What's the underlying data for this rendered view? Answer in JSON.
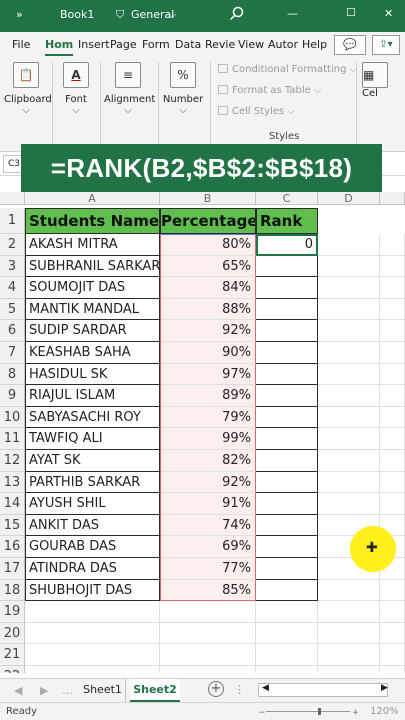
{
  "titlebar": {
    "qat": "»",
    "filename": "Book1",
    "sensitivity": "General",
    "search_icon": "search-icon",
    "minimize": "—",
    "restore": "☐",
    "close": "✕"
  },
  "ribbon_tabs": [
    "File",
    "Hom",
    "Insert",
    "Page",
    "Form",
    "Data",
    "Revie",
    "View",
    "Autor",
    "Help"
  ],
  "ribbon_active_tab": "Hom",
  "ribbon": {
    "clipboard": "Clipboard",
    "font": "Font",
    "alignment": "Alignment",
    "number": "Number",
    "number_symbol": "%",
    "font_symbol": "A",
    "styles": {
      "conditional": "Conditional Formatting",
      "table": "Format as Table",
      "cell": "Cell Styles",
      "title": "Styles"
    },
    "cells": "Cel"
  },
  "formula_bar": {
    "name_box": "C3",
    "banner": "=RANK(B2,$B$2:$B$18)"
  },
  "columns": [
    "A",
    "B",
    "C",
    "D"
  ],
  "headers": {
    "name": "Students Name",
    "percentage": "Percentage",
    "rank": "Rank"
  },
  "rows": [
    {
      "name": "AKASH MITRA",
      "percentage": "80%",
      "rank": "0"
    },
    {
      "name": "SUBHRANIL SARKAR",
      "percentage": "65%",
      "rank": ""
    },
    {
      "name": "SOUMOJIT DAS",
      "percentage": "84%",
      "rank": ""
    },
    {
      "name": "MANTIK MANDAL",
      "percentage": "88%",
      "rank": ""
    },
    {
      "name": "SUDIP SARDAR",
      "percentage": "92%",
      "rank": ""
    },
    {
      "name": "KEASHAB SAHA",
      "percentage": "90%",
      "rank": ""
    },
    {
      "name": "HASIDUL SK",
      "percentage": "97%",
      "rank": ""
    },
    {
      "name": "RIAJUL ISLAM",
      "percentage": "89%",
      "rank": ""
    },
    {
      "name": "SABYASACHI ROY",
      "percentage": "79%",
      "rank": ""
    },
    {
      "name": "TAWFIQ ALI",
      "percentage": "99%",
      "rank": ""
    },
    {
      "name": "AYAT SK",
      "percentage": "82%",
      "rank": ""
    },
    {
      "name": "PARTHIB SARKAR",
      "percentage": "92%",
      "rank": ""
    },
    {
      "name": "AYUSH SHIL",
      "percentage": "91%",
      "rank": ""
    },
    {
      "name": "ANKIT DAS",
      "percentage": "74%",
      "rank": ""
    },
    {
      "name": "GOURAB DAS",
      "percentage": "69%",
      "rank": ""
    },
    {
      "name": "ATINDRA DAS",
      "percentage": "77%",
      "rank": ""
    },
    {
      "name": "SHUBHOJIT DAS",
      "percentage": "85%",
      "rank": ""
    }
  ],
  "row_numbers": [
    "1",
    "2",
    "3",
    "4",
    "5",
    "6",
    "7",
    "8",
    "9",
    "10",
    "11",
    "12",
    "13",
    "14",
    "15",
    "16",
    "17",
    "18",
    "19",
    "20",
    "21",
    "22"
  ],
  "sheets": [
    "Sheet1",
    "Sheet2"
  ],
  "active_sheet": "Sheet2",
  "status": {
    "ready": "Ready",
    "zoom": "120%"
  },
  "colors": {
    "excel_green": "#217346",
    "header_green": "#5fbe4e",
    "cursor_yellow": "#ffef1a"
  }
}
